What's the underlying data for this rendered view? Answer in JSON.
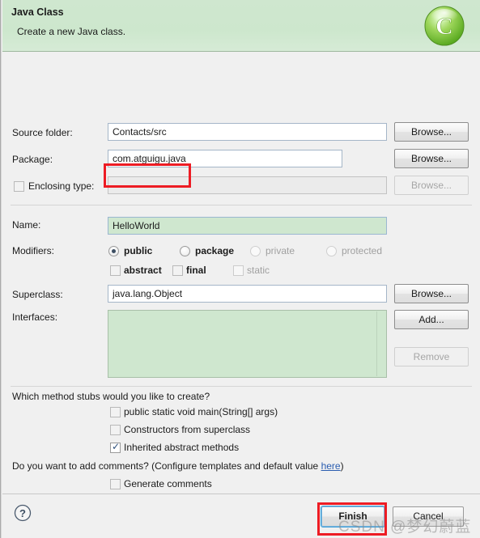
{
  "header": {
    "title": "Java Class",
    "description": "Create a new Java class.",
    "icon": "java-class-wizard-icon"
  },
  "form": {
    "source_folder": {
      "label": "Source folder:",
      "value": "Contacts/src",
      "browse_label": "Browse..."
    },
    "package": {
      "label": "Package:",
      "value": "com.atguigu.java",
      "browse_label": "Browse..."
    },
    "enclosing_type": {
      "label": "Enclosing type:",
      "value": "",
      "checked": false,
      "browse_label": "Browse..."
    },
    "name": {
      "label": "Name:",
      "value": "HelloWorld"
    },
    "modifiers": {
      "label": "Modifiers:",
      "radios": [
        {
          "label": "public",
          "selected": true,
          "enabled": true
        },
        {
          "label": "package",
          "selected": false,
          "enabled": true
        },
        {
          "label": "private",
          "selected": false,
          "enabled": false
        },
        {
          "label": "protected",
          "selected": false,
          "enabled": false
        }
      ],
      "checkboxes": [
        {
          "label": "abstract",
          "checked": false,
          "enabled": true
        },
        {
          "label": "final",
          "checked": false,
          "enabled": true
        },
        {
          "label": "static",
          "checked": false,
          "enabled": false
        }
      ]
    },
    "superclass": {
      "label": "Superclass:",
      "value": "java.lang.Object",
      "browse_label": "Browse..."
    },
    "interfaces": {
      "label": "Interfaces:",
      "items": [],
      "add_label": "Add...",
      "remove_label": "Remove"
    }
  },
  "stubs": {
    "question": "Which method stubs would you like to create?",
    "options": [
      {
        "label": "public static void main(String[] args)",
        "checked": false
      },
      {
        "label": "Constructors from superclass",
        "checked": false
      },
      {
        "label": "Inherited abstract methods",
        "checked": true
      }
    ]
  },
  "comments": {
    "question_prefix": "Do you want to add comments? (Configure templates and default value ",
    "link_label": "here",
    "question_suffix": ")",
    "generate": {
      "label": "Generate comments",
      "checked": false
    }
  },
  "footer": {
    "help_label": "?",
    "finish_label": "Finish",
    "cancel_label": "Cancel"
  },
  "watermark": {
    "text": "CSDN @梦幻蔚蓝"
  },
  "colors": {
    "header_green": "#cde7cd",
    "field_green": "#cfe7cf",
    "annotation_red": "#ed1c24",
    "link_blue": "#2a5db0",
    "focus_blue": "#3c9fdb"
  }
}
